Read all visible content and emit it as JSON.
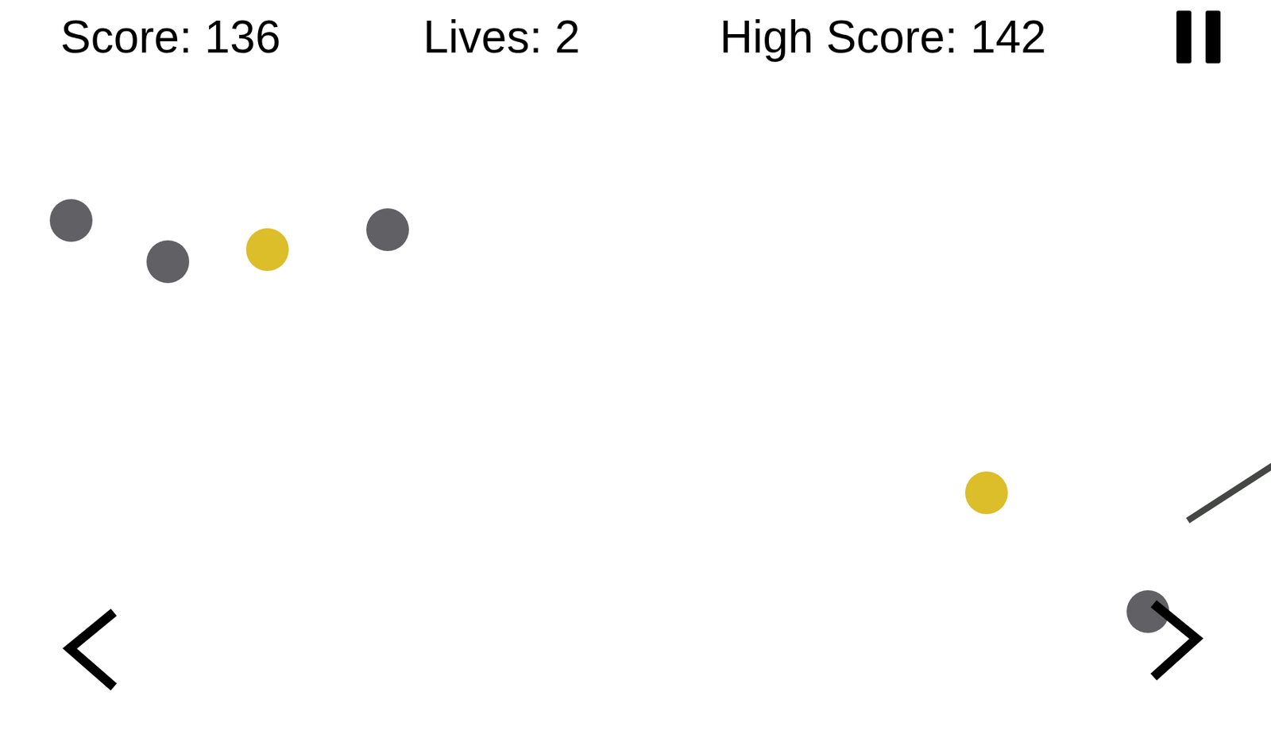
{
  "hud": {
    "score": "Score: 136",
    "lives": "Lives: 2",
    "high_score": "High Score: 142"
  },
  "balls": [
    {
      "color": "#616064"
    },
    {
      "color": "#616064"
    },
    {
      "color": "#dcbd2a"
    },
    {
      "color": "#616064"
    },
    {
      "color": "#dcbd2a"
    },
    {
      "color": "#616064"
    }
  ]
}
